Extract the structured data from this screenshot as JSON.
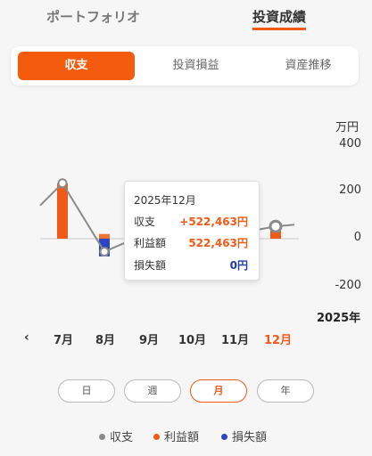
{
  "top_tabs": {
    "left": "ポートフォリオ",
    "right": "投資成績"
  },
  "segments": [
    "収支",
    "投資損益",
    "資産推移"
  ],
  "colors": {
    "accent": "#f05a16",
    "line": "#8a8a8a",
    "loss": "#2b45c4"
  },
  "chart_data": {
    "type": "bar",
    "categories": [
      "7月",
      "8月",
      "9月",
      "10月",
      "11月",
      "12月"
    ],
    "series": [
      {
        "name": "収支",
        "type": "line",
        "values": [
          235,
          -55,
          25,
          -5,
          20,
          52
        ]
      },
      {
        "name": "利益額",
        "type": "bar",
        "values": [
          235,
          20,
          30,
          0,
          0,
          52
        ]
      },
      {
        "name": "損失額",
        "type": "bar",
        "values": [
          0,
          -75,
          0,
          -25,
          0,
          0
        ]
      }
    ],
    "unit": "万円",
    "y_ticks": [
      "400",
      "200",
      "0",
      "-200"
    ],
    "ylim": [
      -200,
      400
    ],
    "xlabel": "2025年",
    "selected_index": 5
  },
  "tooltip": {
    "title": "2025年12月",
    "rows": [
      {
        "label": "収支",
        "value": "+522,463円"
      },
      {
        "label": "利益額",
        "value": "522,463円"
      },
      {
        "label": "損失額",
        "value": "0円"
      }
    ]
  },
  "nav": {
    "prev_icon": "chevron-left-icon",
    "prev_glyph": "‹"
  },
  "periods": [
    "日",
    "週",
    "月",
    "年"
  ],
  "active_period": "月"
}
